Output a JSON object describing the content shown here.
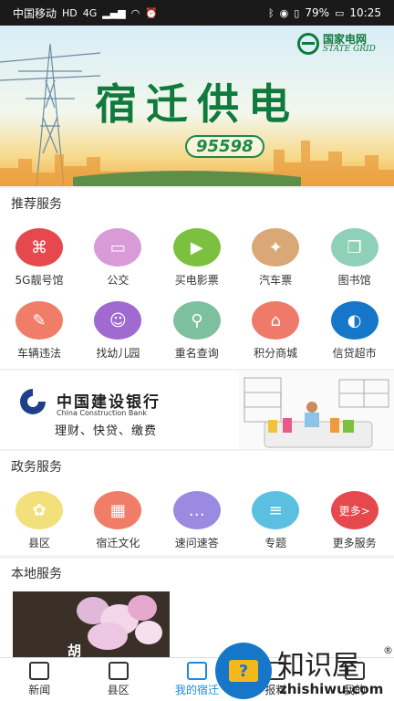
{
  "status_bar": {
    "carrier": "中国移动",
    "network_badge": "HD",
    "network_type": "4G",
    "battery": "79%",
    "time": "10:25"
  },
  "banner": {
    "title": "宿迁供电",
    "hotline": "95598",
    "brand_cn": "国家电网",
    "brand_en": "STATE GRID"
  },
  "recommended": {
    "title": "推荐服务",
    "items": [
      {
        "label": "5G靓号馆",
        "icon": "knot-icon",
        "color": "#e5484d"
      },
      {
        "label": "公交",
        "icon": "bus-icon",
        "color": "#d99bd8"
      },
      {
        "label": "买电影票",
        "icon": "film-icon",
        "color": "#7cc040"
      },
      {
        "label": "汽车票",
        "icon": "ticket-icon",
        "color": "#d9a876"
      },
      {
        "label": "图书馆",
        "icon": "book-icon",
        "color": "#8fd0b8"
      },
      {
        "label": "车辆违法",
        "icon": "clipboard-icon",
        "color": "#f07d68"
      },
      {
        "label": "找幼儿园",
        "icon": "child-icon",
        "color": "#a06ad0"
      },
      {
        "label": "重名查询",
        "icon": "magnifier-icon",
        "color": "#7dc0a0"
      },
      {
        "label": "积分商城",
        "icon": "shop-icon",
        "color": "#f07a6a"
      },
      {
        "label": "信贷超市",
        "icon": "ccb-bank-icon",
        "color": "#1677c9"
      }
    ]
  },
  "ad": {
    "bank_cn": "中国建设银行",
    "bank_en": "China Construction Bank",
    "slogan": "理财、快贷、缴费"
  },
  "government": {
    "title": "政务服务",
    "items": [
      {
        "label": "县区",
        "icon": "map-icon",
        "color": "#f2e07a"
      },
      {
        "label": "宿迁文化",
        "icon": "picture-icon",
        "color": "#f07d68"
      },
      {
        "label": "速问速答",
        "icon": "chat-icon",
        "color": "#9a8ae0"
      },
      {
        "label": "专题",
        "icon": "newspaper-icon",
        "color": "#5bc0e0"
      },
      {
        "label": "更多服务",
        "icon": "more-icon",
        "color": "#e5484d",
        "badge": "更多>"
      }
    ]
  },
  "local": {
    "title": "本地服务",
    "thumb_text": "胡"
  },
  "bottom_nav": [
    {
      "label": "新闻",
      "icon": "news-icon",
      "active": false
    },
    {
      "label": "县区",
      "icon": "map-book-icon",
      "active": false
    },
    {
      "label": "我的宿迁",
      "icon": "building-icon",
      "active": true
    },
    {
      "label": "报料",
      "icon": "report-icon",
      "active": false
    },
    {
      "label": "我的",
      "icon": "profile-icon",
      "active": false
    }
  ],
  "watermark": {
    "text": "知识屋",
    "url": "zhishiwu.com",
    "reg": "®"
  },
  "colors": {
    "accent": "#1a8be0",
    "grid_green": "#0f7a3b"
  }
}
